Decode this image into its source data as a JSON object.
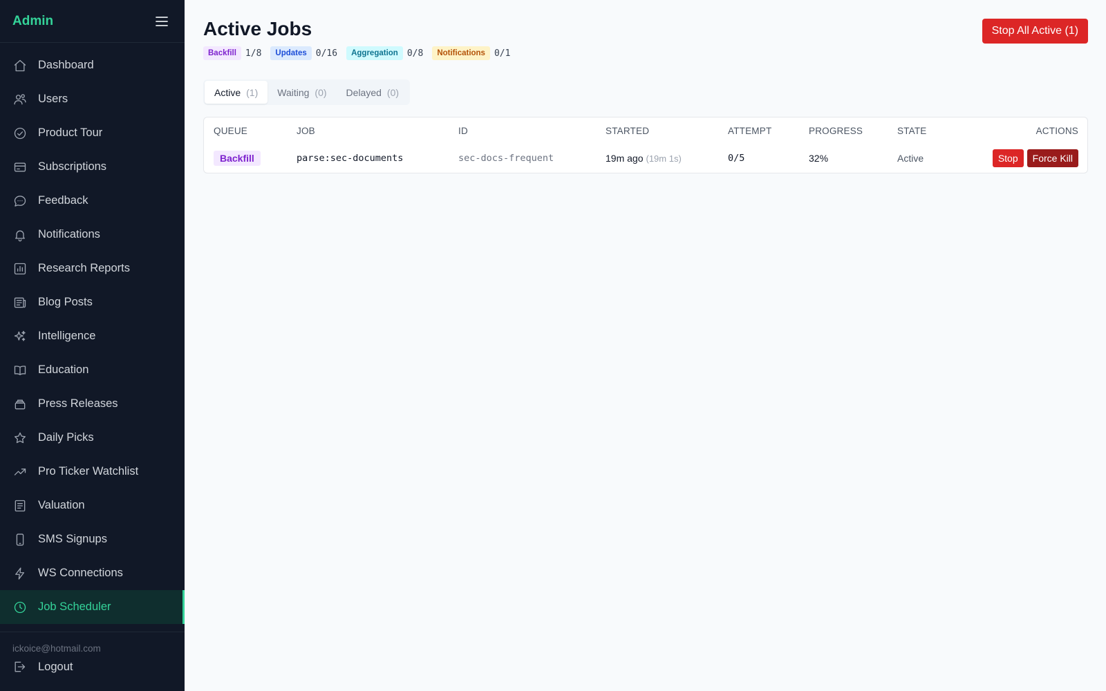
{
  "sidebar": {
    "title": "Admin",
    "items": [
      {
        "label": "Dashboard",
        "icon": "home-icon"
      },
      {
        "label": "Users",
        "icon": "users-icon"
      },
      {
        "label": "Product Tour",
        "icon": "check-circle-icon"
      },
      {
        "label": "Subscriptions",
        "icon": "credit-card-icon"
      },
      {
        "label": "Feedback",
        "icon": "chat-bubble-icon"
      },
      {
        "label": "Notifications",
        "icon": "bell-icon"
      },
      {
        "label": "Research Reports",
        "icon": "bar-chart-icon"
      },
      {
        "label": "Blog Posts",
        "icon": "newspaper-icon"
      },
      {
        "label": "Intelligence",
        "icon": "sparkles-icon"
      },
      {
        "label": "Education",
        "icon": "book-open-icon"
      },
      {
        "label": "Press Releases",
        "icon": "inbox-stack-icon"
      },
      {
        "label": "Daily Picks",
        "icon": "star-icon"
      },
      {
        "label": "Pro Ticker Watchlist",
        "icon": "trending-up-icon"
      },
      {
        "label": "Valuation",
        "icon": "document-list-icon"
      },
      {
        "label": "SMS Signups",
        "icon": "phone-icon"
      },
      {
        "label": "WS Connections",
        "icon": "bolt-icon"
      },
      {
        "label": "Job Scheduler",
        "icon": "clock-icon",
        "active": true
      }
    ],
    "user_email": "ickoice@hotmail.com",
    "logout_label": "Logout"
  },
  "main": {
    "title": "Active Jobs",
    "stop_all_label": "Stop All Active (1)",
    "queues": [
      {
        "name": "Backfill",
        "count": "1/8",
        "color": "#7e22ce"
      },
      {
        "name": "Updates",
        "count": "0/16",
        "color": "#1d4ed8"
      },
      {
        "name": "Aggregation",
        "count": "0/8",
        "color": "#0e7490"
      },
      {
        "name": "Notifications",
        "count": "0/1",
        "color": "#b45309"
      }
    ],
    "tabs": [
      {
        "label": "Active",
        "count": "(1)",
        "active": true
      },
      {
        "label": "Waiting",
        "count": "(0)"
      },
      {
        "label": "Delayed",
        "count": "(0)"
      }
    ],
    "table": {
      "headers": {
        "queue": "QUEUE",
        "job": "JOB",
        "id": "ID",
        "started": "STARTED",
        "attempt": "ATTEMPT",
        "progress": "PROGRESS",
        "state": "STATE",
        "actions": "ACTIONS"
      },
      "rows": [
        {
          "queue": "Backfill",
          "job": "parse:sec-documents",
          "id": "sec-docs-frequent",
          "started": "19m ago",
          "started_detail": "(19m 1s)",
          "attempt": "0/5",
          "progress": "32%",
          "state": "Active",
          "stop_label": "Stop",
          "kill_label": "Force Kill"
        }
      ]
    }
  },
  "colors": {
    "sidebar_bg": "#111827",
    "accent": "#34d399",
    "danger": "#dc2626",
    "danger_dark": "#991b1b"
  }
}
